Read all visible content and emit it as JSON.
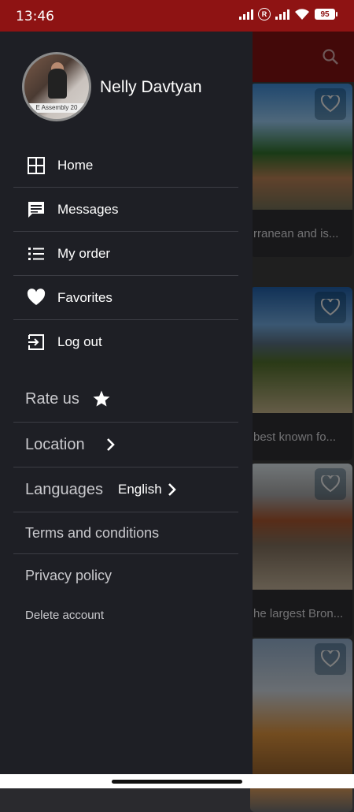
{
  "status_bar": {
    "time": "13:46",
    "battery": "95"
  },
  "user": {
    "name": "Nelly Davtyan",
    "avatar_caption": "E Assembly 20"
  },
  "menu": [
    {
      "label": "Home",
      "icon": "grid-icon"
    },
    {
      "label": "Messages",
      "icon": "message-icon"
    },
    {
      "label": "My order",
      "icon": "list-icon"
    },
    {
      "label": "Favorites",
      "icon": "heart-icon"
    },
    {
      "label": "Log out",
      "icon": "logout-icon"
    }
  ],
  "secondary": {
    "rate_us": "Rate us",
    "location": "Location",
    "languages": "Languages",
    "language_value": "English",
    "terms": "Terms and conditions",
    "privacy": "Privacy policy",
    "delete_account": "Delete account"
  },
  "background_cards": [
    {
      "caption": "rranean and is..."
    },
    {
      "caption": "best known fo..."
    },
    {
      "caption": "he largest Bron..."
    },
    {
      "caption": ""
    }
  ],
  "colors": {
    "accent": "#8e1313",
    "drawer_bg": "#1e1f25"
  }
}
